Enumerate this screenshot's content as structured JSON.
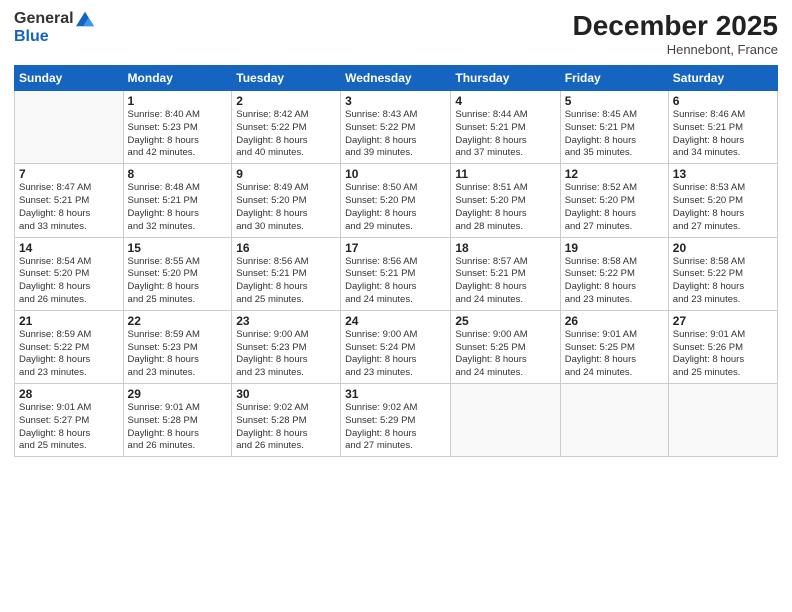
{
  "logo": {
    "line1": "General",
    "line2": "Blue"
  },
  "title": "December 2025",
  "location": "Hennebont, France",
  "days_header": [
    "Sunday",
    "Monday",
    "Tuesday",
    "Wednesday",
    "Thursday",
    "Friday",
    "Saturday"
  ],
  "weeks": [
    [
      {
        "day": "",
        "sunrise": "",
        "sunset": "",
        "daylight": ""
      },
      {
        "day": "1",
        "sunrise": "Sunrise: 8:40 AM",
        "sunset": "Sunset: 5:23 PM",
        "daylight": "Daylight: 8 hours and 42 minutes."
      },
      {
        "day": "2",
        "sunrise": "Sunrise: 8:42 AM",
        "sunset": "Sunset: 5:22 PM",
        "daylight": "Daylight: 8 hours and 40 minutes."
      },
      {
        "day": "3",
        "sunrise": "Sunrise: 8:43 AM",
        "sunset": "Sunset: 5:22 PM",
        "daylight": "Daylight: 8 hours and 39 minutes."
      },
      {
        "day": "4",
        "sunrise": "Sunrise: 8:44 AM",
        "sunset": "Sunset: 5:21 PM",
        "daylight": "Daylight: 8 hours and 37 minutes."
      },
      {
        "day": "5",
        "sunrise": "Sunrise: 8:45 AM",
        "sunset": "Sunset: 5:21 PM",
        "daylight": "Daylight: 8 hours and 35 minutes."
      },
      {
        "day": "6",
        "sunrise": "Sunrise: 8:46 AM",
        "sunset": "Sunset: 5:21 PM",
        "daylight": "Daylight: 8 hours and 34 minutes."
      }
    ],
    [
      {
        "day": "7",
        "sunrise": "Sunrise: 8:47 AM",
        "sunset": "Sunset: 5:21 PM",
        "daylight": "Daylight: 8 hours and 33 minutes."
      },
      {
        "day": "8",
        "sunrise": "Sunrise: 8:48 AM",
        "sunset": "Sunset: 5:21 PM",
        "daylight": "Daylight: 8 hours and 32 minutes."
      },
      {
        "day": "9",
        "sunrise": "Sunrise: 8:49 AM",
        "sunset": "Sunset: 5:20 PM",
        "daylight": "Daylight: 8 hours and 30 minutes."
      },
      {
        "day": "10",
        "sunrise": "Sunrise: 8:50 AM",
        "sunset": "Sunset: 5:20 PM",
        "daylight": "Daylight: 8 hours and 29 minutes."
      },
      {
        "day": "11",
        "sunrise": "Sunrise: 8:51 AM",
        "sunset": "Sunset: 5:20 PM",
        "daylight": "Daylight: 8 hours and 28 minutes."
      },
      {
        "day": "12",
        "sunrise": "Sunrise: 8:52 AM",
        "sunset": "Sunset: 5:20 PM",
        "daylight": "Daylight: 8 hours and 27 minutes."
      },
      {
        "day": "13",
        "sunrise": "Sunrise: 8:53 AM",
        "sunset": "Sunset: 5:20 PM",
        "daylight": "Daylight: 8 hours and 27 minutes."
      }
    ],
    [
      {
        "day": "14",
        "sunrise": "Sunrise: 8:54 AM",
        "sunset": "Sunset: 5:20 PM",
        "daylight": "Daylight: 8 hours and 26 minutes."
      },
      {
        "day": "15",
        "sunrise": "Sunrise: 8:55 AM",
        "sunset": "Sunset: 5:20 PM",
        "daylight": "Daylight: 8 hours and 25 minutes."
      },
      {
        "day": "16",
        "sunrise": "Sunrise: 8:56 AM",
        "sunset": "Sunset: 5:21 PM",
        "daylight": "Daylight: 8 hours and 25 minutes."
      },
      {
        "day": "17",
        "sunrise": "Sunrise: 8:56 AM",
        "sunset": "Sunset: 5:21 PM",
        "daylight": "Daylight: 8 hours and 24 minutes."
      },
      {
        "day": "18",
        "sunrise": "Sunrise: 8:57 AM",
        "sunset": "Sunset: 5:21 PM",
        "daylight": "Daylight: 8 hours and 24 minutes."
      },
      {
        "day": "19",
        "sunrise": "Sunrise: 8:58 AM",
        "sunset": "Sunset: 5:22 PM",
        "daylight": "Daylight: 8 hours and 23 minutes."
      },
      {
        "day": "20",
        "sunrise": "Sunrise: 8:58 AM",
        "sunset": "Sunset: 5:22 PM",
        "daylight": "Daylight: 8 hours and 23 minutes."
      }
    ],
    [
      {
        "day": "21",
        "sunrise": "Sunrise: 8:59 AM",
        "sunset": "Sunset: 5:22 PM",
        "daylight": "Daylight: 8 hours and 23 minutes."
      },
      {
        "day": "22",
        "sunrise": "Sunrise: 8:59 AM",
        "sunset": "Sunset: 5:23 PM",
        "daylight": "Daylight: 8 hours and 23 minutes."
      },
      {
        "day": "23",
        "sunrise": "Sunrise: 9:00 AM",
        "sunset": "Sunset: 5:23 PM",
        "daylight": "Daylight: 8 hours and 23 minutes."
      },
      {
        "day": "24",
        "sunrise": "Sunrise: 9:00 AM",
        "sunset": "Sunset: 5:24 PM",
        "daylight": "Daylight: 8 hours and 23 minutes."
      },
      {
        "day": "25",
        "sunrise": "Sunrise: 9:00 AM",
        "sunset": "Sunset: 5:25 PM",
        "daylight": "Daylight: 8 hours and 24 minutes."
      },
      {
        "day": "26",
        "sunrise": "Sunrise: 9:01 AM",
        "sunset": "Sunset: 5:25 PM",
        "daylight": "Daylight: 8 hours and 24 minutes."
      },
      {
        "day": "27",
        "sunrise": "Sunrise: 9:01 AM",
        "sunset": "Sunset: 5:26 PM",
        "daylight": "Daylight: 8 hours and 25 minutes."
      }
    ],
    [
      {
        "day": "28",
        "sunrise": "Sunrise: 9:01 AM",
        "sunset": "Sunset: 5:27 PM",
        "daylight": "Daylight: 8 hours and 25 minutes."
      },
      {
        "day": "29",
        "sunrise": "Sunrise: 9:01 AM",
        "sunset": "Sunset: 5:28 PM",
        "daylight": "Daylight: 8 hours and 26 minutes."
      },
      {
        "day": "30",
        "sunrise": "Sunrise: 9:02 AM",
        "sunset": "Sunset: 5:28 PM",
        "daylight": "Daylight: 8 hours and 26 minutes."
      },
      {
        "day": "31",
        "sunrise": "Sunrise: 9:02 AM",
        "sunset": "Sunset: 5:29 PM",
        "daylight": "Daylight: 8 hours and 27 minutes."
      },
      {
        "day": "",
        "sunrise": "",
        "sunset": "",
        "daylight": ""
      },
      {
        "day": "",
        "sunrise": "",
        "sunset": "",
        "daylight": ""
      },
      {
        "day": "",
        "sunrise": "",
        "sunset": "",
        "daylight": ""
      }
    ]
  ]
}
